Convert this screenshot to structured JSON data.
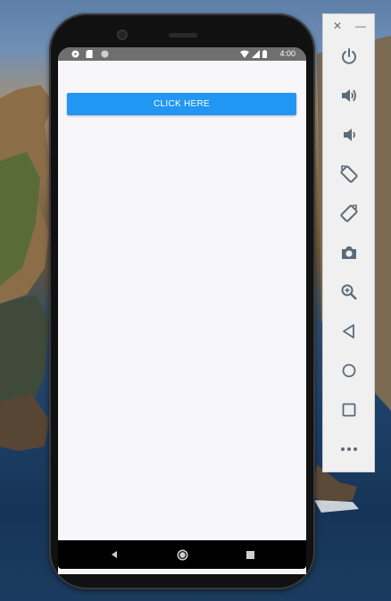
{
  "status_bar": {
    "time": "4:00",
    "left_icons": [
      "play-protect-icon",
      "sd-card-icon",
      "circle-indicator-icon"
    ],
    "right_icons": [
      "wifi-icon",
      "cell-signal-icon",
      "battery-icon"
    ]
  },
  "app": {
    "button_label": "CLICK HERE",
    "button_color": "#2196f3",
    "screen_bg": "#f7f7f9"
  },
  "nav_bar": {
    "icons": [
      "back-icon",
      "home-icon",
      "recents-icon"
    ]
  },
  "emulator_toolbar": {
    "close_glyph": "✕",
    "minimize_glyph": "—",
    "icon_color": "#5b6b7a",
    "buttons": [
      {
        "name": "power-icon"
      },
      {
        "name": "volume-up-icon"
      },
      {
        "name": "volume-down-icon"
      },
      {
        "name": "rotate-left-icon"
      },
      {
        "name": "rotate-right-icon"
      },
      {
        "name": "camera-icon"
      },
      {
        "name": "zoom-icon"
      },
      {
        "name": "back-icon"
      },
      {
        "name": "home-icon"
      },
      {
        "name": "overview-icon"
      },
      {
        "name": "more-icon"
      }
    ]
  }
}
